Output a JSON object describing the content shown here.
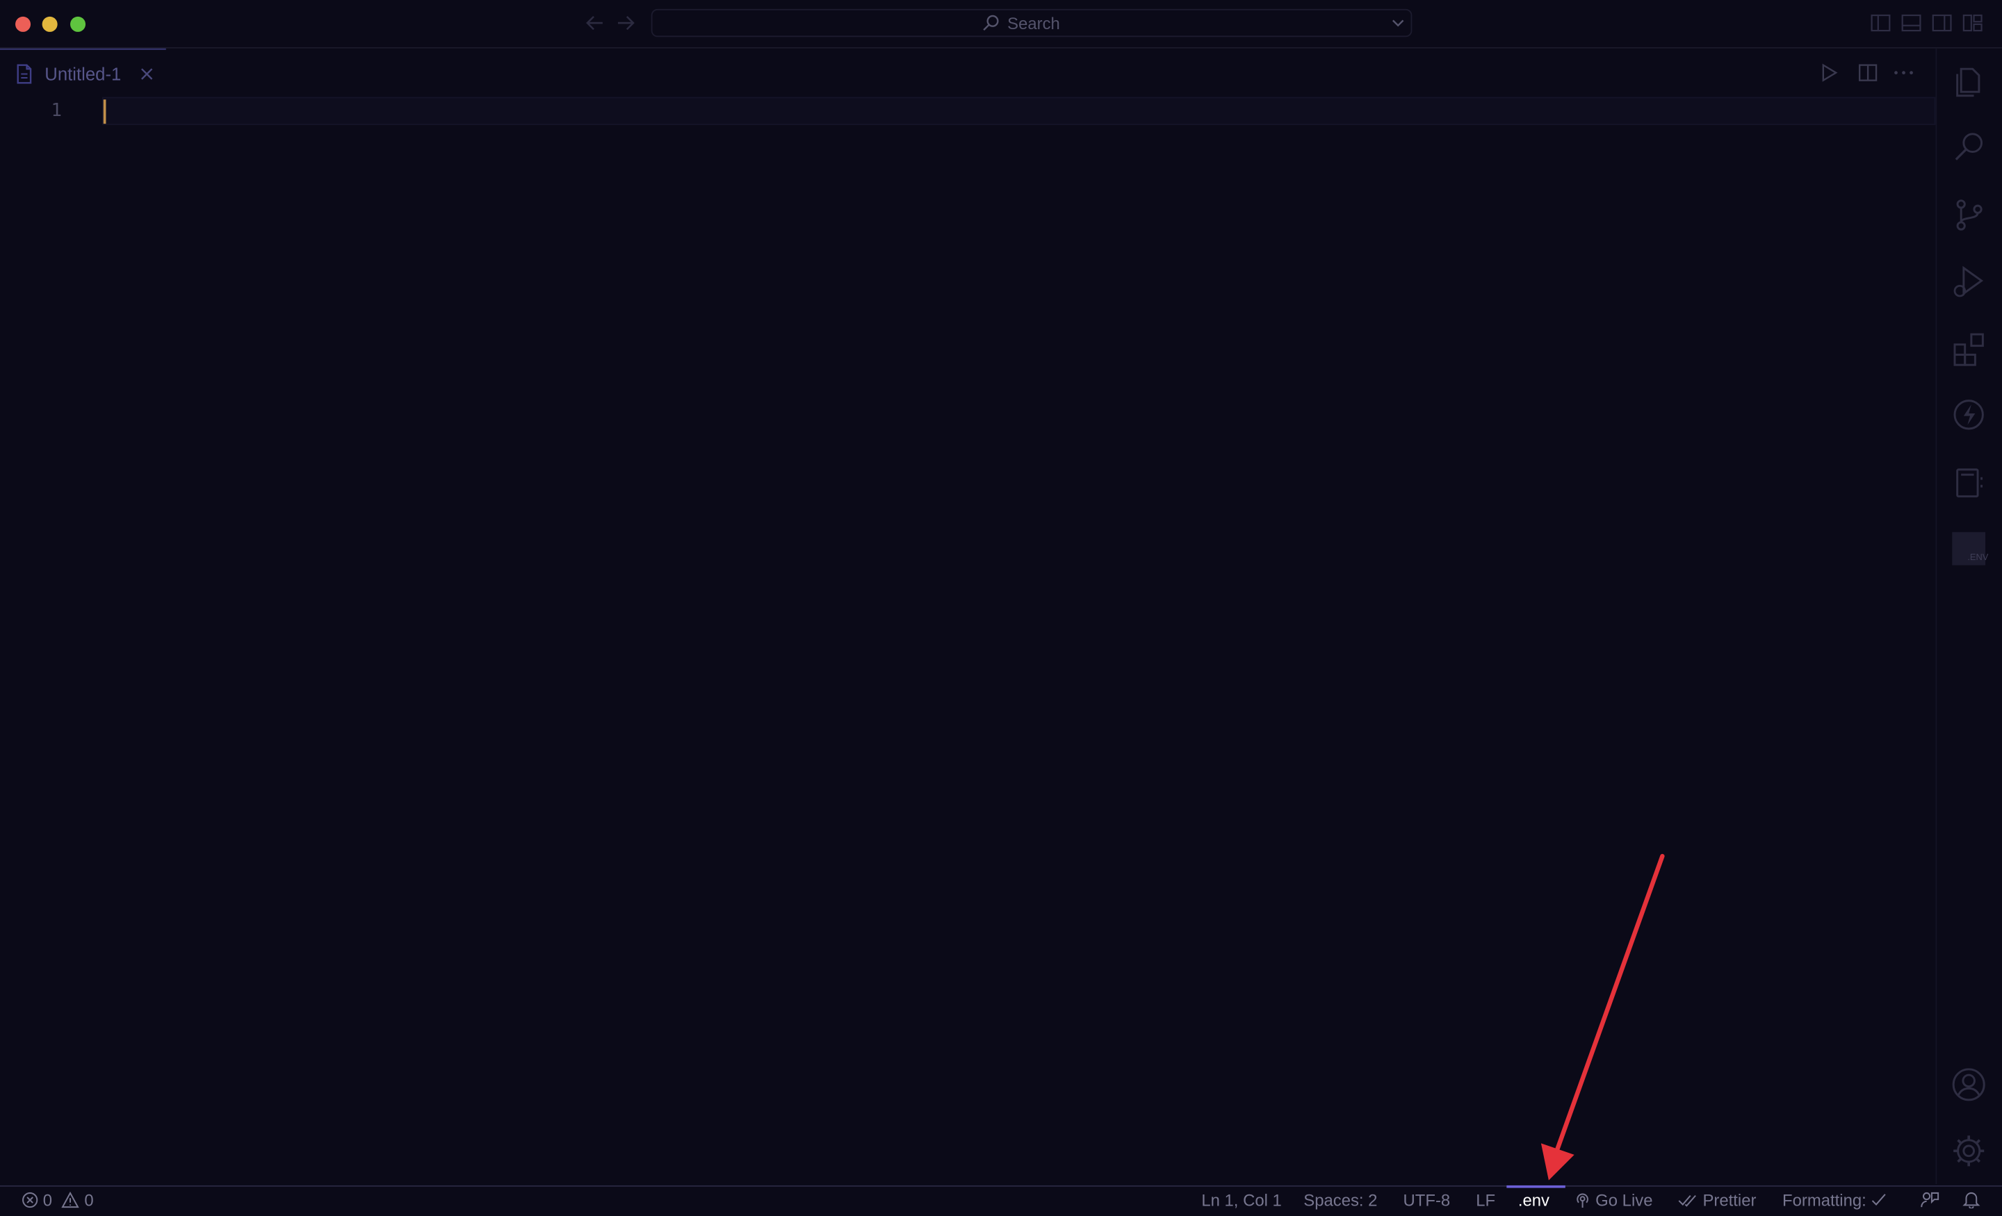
{
  "titlebar": {
    "search_label": "Search"
  },
  "tab": {
    "label": "Untitled-1"
  },
  "editor": {
    "line_numbers": [
      "1"
    ]
  },
  "activity_bar": {
    "env_icon_label": ".ENV"
  },
  "statusbar": {
    "errors": "0",
    "warnings": "0",
    "position": "Ln 1, Col 1",
    "indentation": "Spaces: 2",
    "encoding": "UTF-8",
    "eol": "LF",
    "language": ".env",
    "go_live": "Go Live",
    "prettier": "Prettier",
    "formatting": "Formatting:"
  },
  "colors": {
    "background": "#0b0a18",
    "cursor": "#c2904a",
    "annotation_arrow": "#e5323a",
    "accent": "#6c5fd6"
  }
}
